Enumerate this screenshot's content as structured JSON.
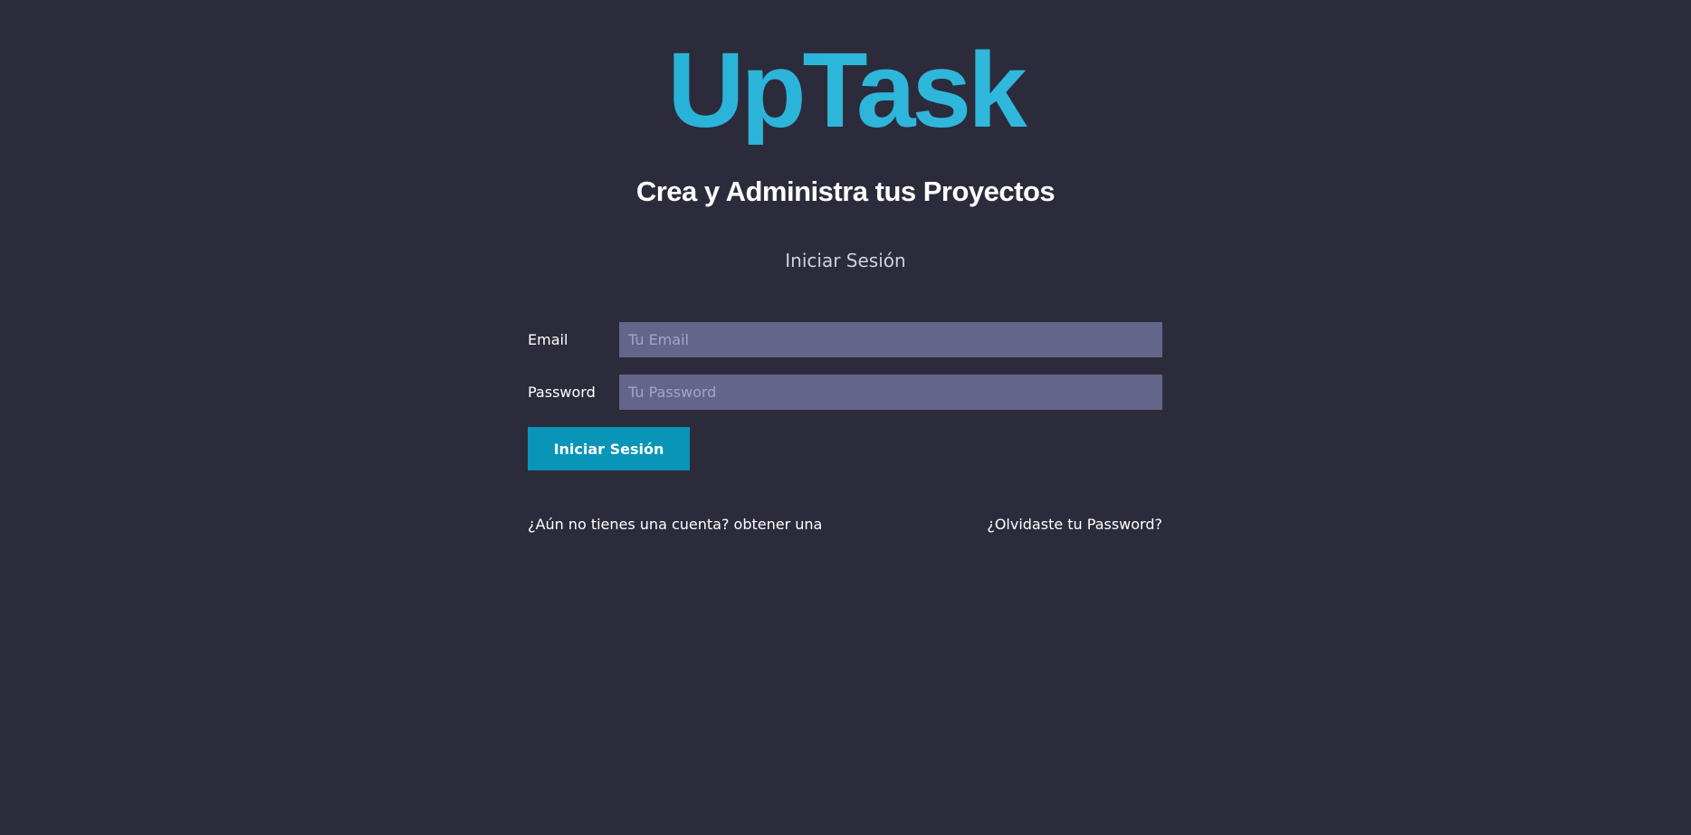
{
  "header": {
    "logo": "UpTask",
    "tagline": "Crea y Administra tus Proyectos"
  },
  "page": {
    "subtitle": "Iniciar Sesión"
  },
  "form": {
    "email": {
      "label": "Email",
      "placeholder": "Tu Email",
      "value": ""
    },
    "password": {
      "label": "Password",
      "placeholder": "Tu Password",
      "value": ""
    },
    "submit_label": "Iniciar Sesión"
  },
  "links": {
    "register": "¿Aún no tienes una cuenta? obtener una",
    "forgot": "¿Olvidaste tu Password?"
  },
  "colors": {
    "background": "#2c2b3b",
    "accent": "#0895b8",
    "logo_gradient_start": "#1ea8d2",
    "logo_gradient_end": "#3cc3e2",
    "input_background": "#64658a"
  }
}
